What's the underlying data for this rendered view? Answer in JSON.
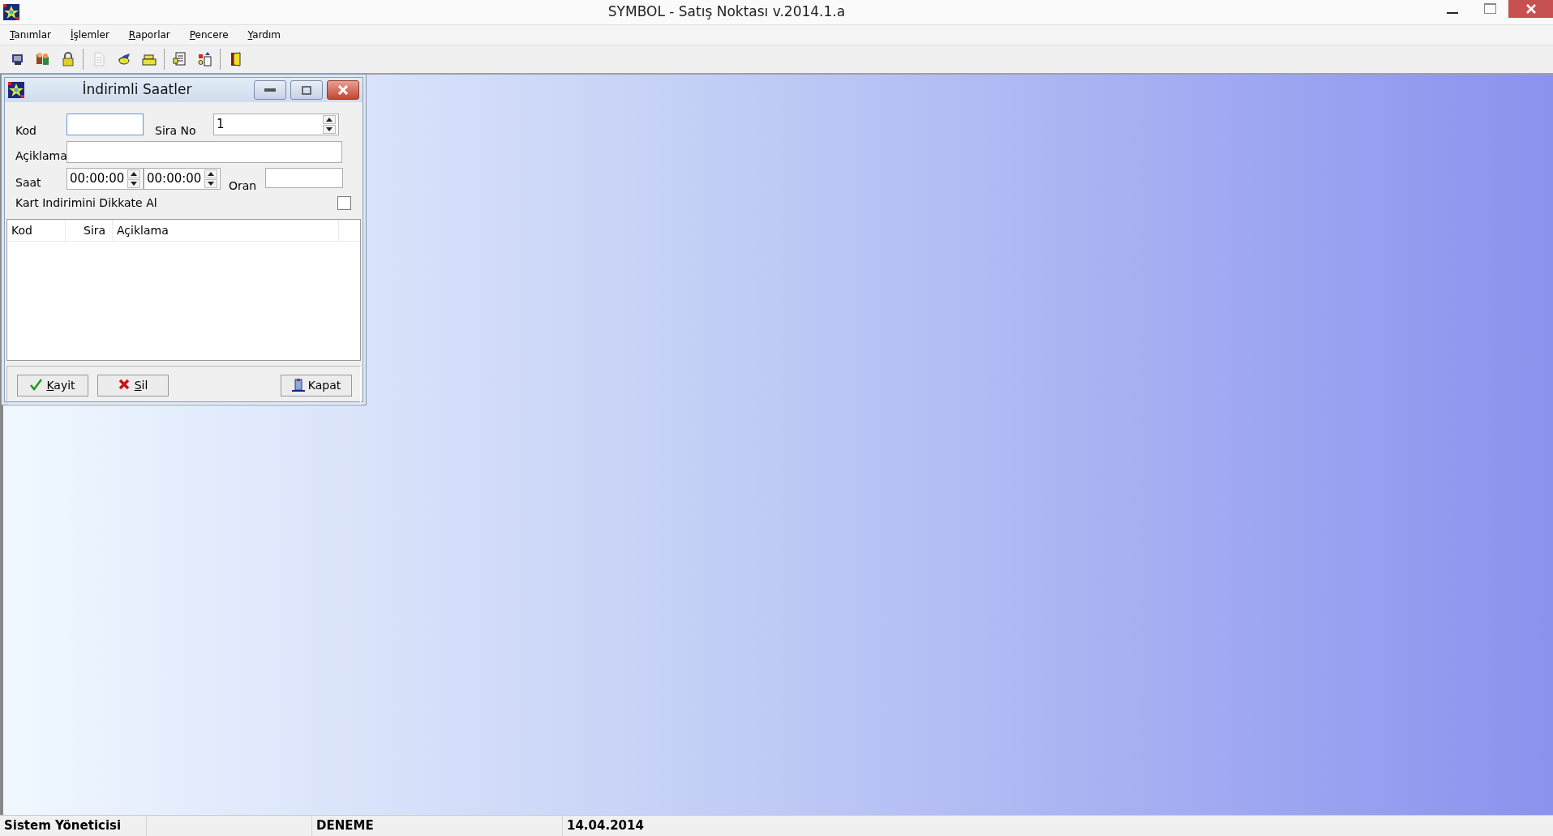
{
  "window": {
    "title": "SYMBOL - Satış Noktası  v.2014.1.a"
  },
  "menu": [
    {
      "label": "Tanımlar"
    },
    {
      "label": "İşlemler"
    },
    {
      "label": "Raporlar"
    },
    {
      "label": "Pencere"
    },
    {
      "label": "Yardım"
    }
  ],
  "toolbar": [
    [
      {
        "disabled": false
      },
      {
        "disabled": false
      },
      {
        "disabled": false
      }
    ],
    [
      {
        "disabled": true
      },
      {
        "disabled": false
      },
      {
        "disabled": false
      }
    ],
    [
      {
        "disabled": false
      },
      {
        "disabled": false
      }
    ],
    [
      {
        "disabled": false
      }
    ]
  ],
  "dialog": {
    "title": "İndirimli Saatler",
    "kod": {
      "label": "Kod",
      "focused": true
    },
    "sira_no": {
      "label": "Sira No",
      "value": "1"
    },
    "aciklama": {
      "label": "Açiklama"
    },
    "saat": {
      "label": "Saat",
      "start": "00:00:00",
      "end": "00:00:00"
    },
    "oran": {
      "label": "Oran"
    },
    "kart_indirimi": {
      "label": "Kart Indirimini Dikkate Al",
      "checked": false
    },
    "grid": {
      "columns": [
        "Kod",
        "Sira",
        "Açiklama"
      ]
    },
    "buttons": [
      {
        "label": "Kayit",
        "kind": "save",
        "underline_first": true
      },
      {
        "label": "Sil",
        "kind": "delete",
        "underline_first": true
      },
      {
        "label": "Kapat",
        "kind": "close",
        "underline_first": false
      }
    ]
  },
  "status_bar": {
    "user": "Sistem Yöneticisi",
    "company": "DENEME",
    "date": "14.04.2014"
  }
}
